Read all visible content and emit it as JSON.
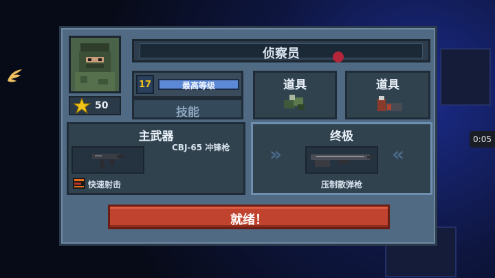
{
  "hud": {
    "timer": "0:05"
  },
  "character": {
    "name": "侦察员",
    "stars": "50",
    "level": "17",
    "level_label": "最高等级",
    "skill_label": "技能"
  },
  "items": [
    {
      "label": "道具",
      "icon": "grenade-icon"
    },
    {
      "label": "道具",
      "icon": "ammo-icon"
    }
  ],
  "primary": {
    "header": "主武器",
    "weapon_name": "CBJ-65 冲锋枪",
    "trait": "快速射击",
    "icon": "smg-icon"
  },
  "ultimate": {
    "header": "终极",
    "weapon_name": "压制散弹枪",
    "icon": "shotgun-icon"
  },
  "ready_label": "就绪！",
  "colors": {
    "ready": "#c0432f",
    "level_bar": "#5c89d6",
    "star": "#f0c419"
  }
}
